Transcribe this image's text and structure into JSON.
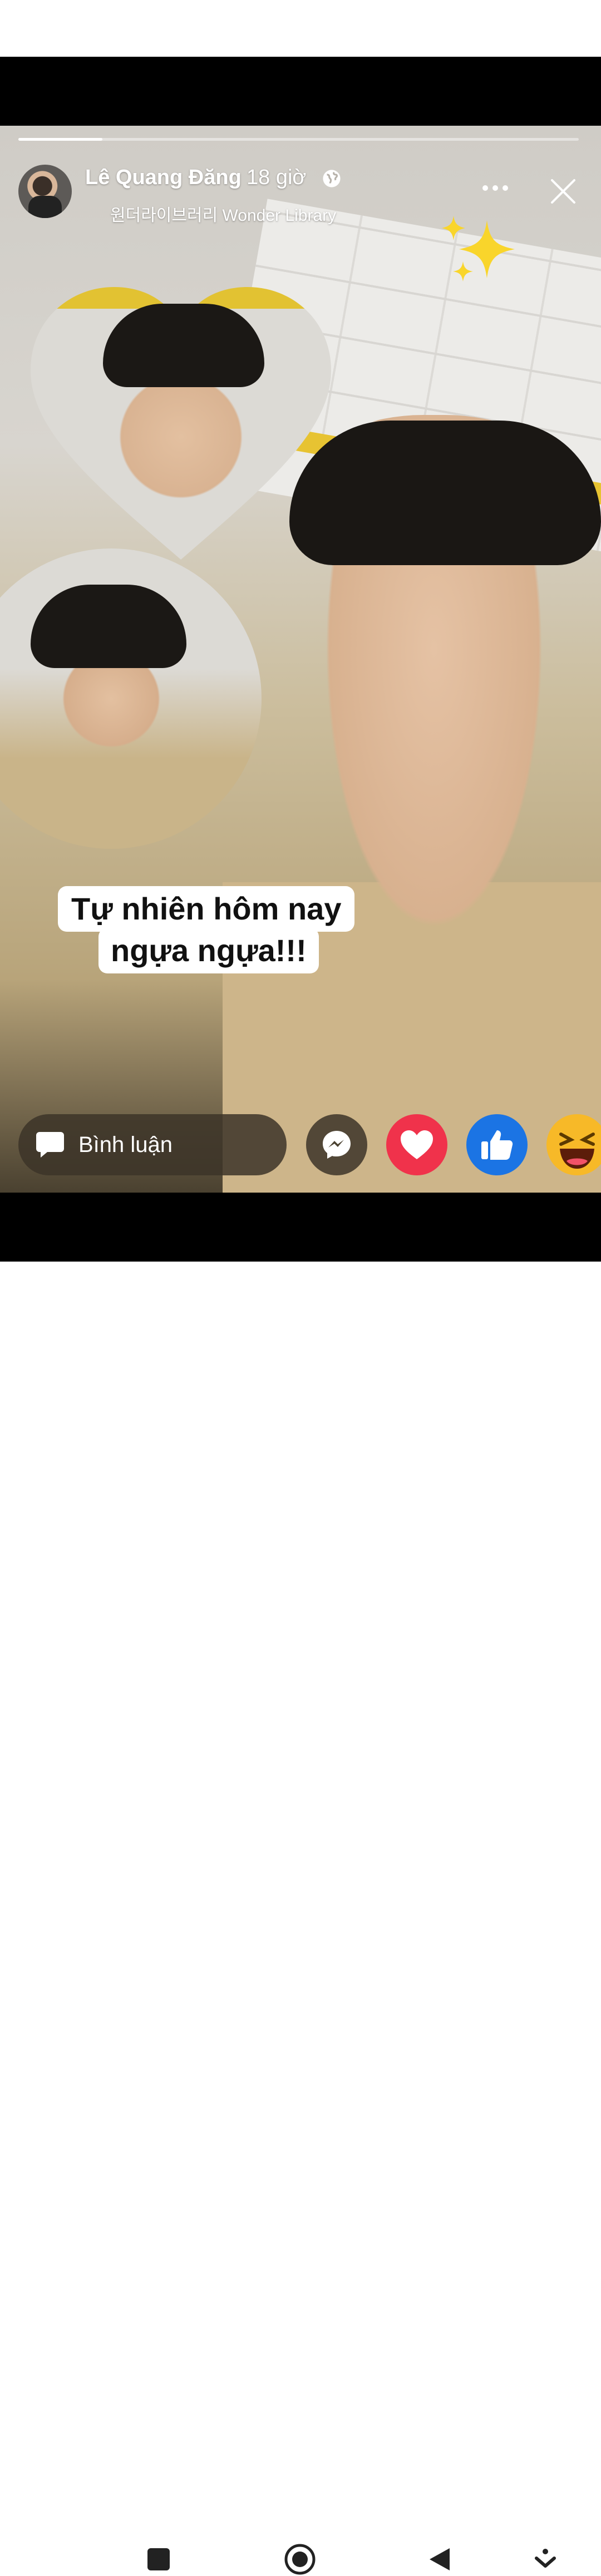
{
  "story": {
    "progress_fraction": 0.15,
    "author": {
      "name": "Lê Quang Đăng",
      "time": "18 giờ"
    },
    "music": {
      "text": "원더라이브러리 Wonder Library"
    },
    "caption": {
      "line1": "Tự nhiên hôm nay",
      "line2": "ngựa ngựa!!!"
    },
    "comment": {
      "label": "Bình luận"
    },
    "icons": {
      "globe": "globe-icon",
      "music": "music-note-icon",
      "more": "more-options-icon",
      "close": "close-icon",
      "comment": "comment-bubble-icon",
      "messenger": "messenger-icon",
      "love": "love-reaction-icon",
      "like": "like-reaction-icon",
      "haha": "haha-reaction-icon",
      "sparkles": "sparkles-sticker"
    },
    "colors": {
      "love": "#f0324b",
      "like": "#1b74e4",
      "haha": "#f7b928"
    }
  },
  "navbar": {
    "icons": [
      "recent-apps-icon",
      "home-icon",
      "back-icon",
      "notification-pull-icon"
    ]
  }
}
